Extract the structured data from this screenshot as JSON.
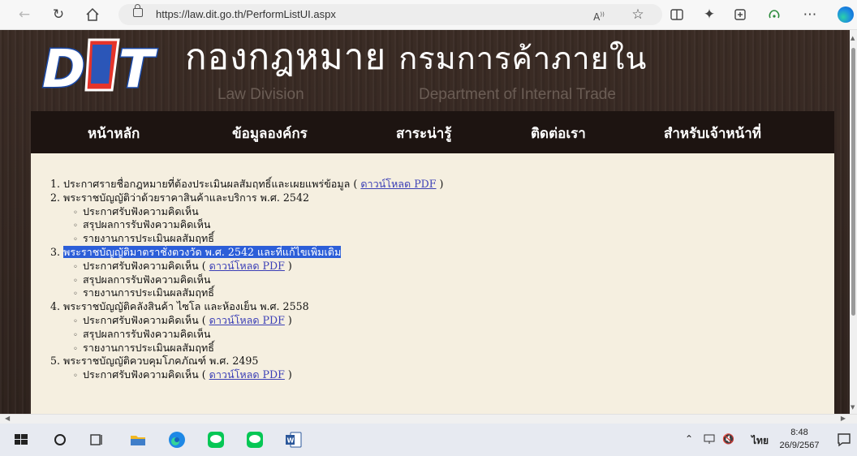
{
  "browser": {
    "url": "https://law.dit.go.th/PerformListUI.aspx",
    "icons": [
      "back-icon",
      "refresh-icon",
      "home-icon",
      "lock-icon",
      "read-aloud-icon",
      "favorite-star-icon",
      "split-screen-icon",
      "favorites-list-icon",
      "collections-icon",
      "performance-icon",
      "more-icon",
      "edge-copilot-icon"
    ]
  },
  "banner": {
    "title_th_part1": "กองกฎหมาย",
    "title_th_part2": "กรมการค้าภายใน",
    "title_en_division": "Law Division",
    "title_en_department": "Department of Internal Trade",
    "logo_text": "DIT"
  },
  "nav": {
    "items": [
      {
        "label": "หน้าหลัก"
      },
      {
        "label": "ข้อมูลองค์กร"
      },
      {
        "label": "สาระน่ารู้"
      },
      {
        "label": "ติดต่อเรา"
      },
      {
        "label": "สำหรับเจ้าหน้าที่"
      }
    ]
  },
  "content": {
    "download_label": "ดาวน์โหลด PDF",
    "items": [
      {
        "type": "main",
        "num": "1.",
        "text": "ประกาศรายชื่อกฎหมายที่ต้องประเมินผลสัมฤทธิ์และเผยแพร่ข้อมูล",
        "link": true
      },
      {
        "type": "main",
        "num": "2.",
        "text": "พระราชบัญญัติว่าด้วยราคาสินค้าและบริการ พ.ศ. 2542"
      },
      {
        "type": "sub",
        "text": "ประกาศรับฟังความคิดเห็น"
      },
      {
        "type": "sub",
        "text": "สรุปผลการรับฟังความคิดเห็น"
      },
      {
        "type": "sub",
        "text": "รายงานการประเมินผลสัมฤทธิ์"
      },
      {
        "type": "main",
        "num": "3.",
        "text": "พระราชบัญญัติมาตราชั่งตวงวัด พ.ศ. 2542 และที่แก้ไขเพิ่มเติม",
        "highlight": true
      },
      {
        "type": "sub",
        "text": "ประกาศรับฟังความคิดเห็น",
        "link": true
      },
      {
        "type": "sub",
        "text": "สรุปผลการรับฟังความคิดเห็น"
      },
      {
        "type": "sub",
        "text": "รายงานการประเมินผลสัมฤทธิ์"
      },
      {
        "type": "main",
        "num": "4.",
        "text": "พระราชบัญญัติคลังสินค้า ไซโล และห้องเย็น พ.ศ. 2558"
      },
      {
        "type": "sub",
        "text": "ประกาศรับฟังความคิดเห็น",
        "link": true
      },
      {
        "type": "sub",
        "text": "สรุปผลการรับฟังความคิดเห็น"
      },
      {
        "type": "sub",
        "text": "รายงานการประเมินผลสัมฤทธิ์"
      },
      {
        "type": "main",
        "num": "5.",
        "text": "พระราชบัญญัติควบคุมโภคภัณฑ์ พ.ศ. 2495"
      },
      {
        "type": "sub",
        "text": "ประกาศรับฟังความคิดเห็น",
        "link": true
      }
    ]
  },
  "taskbar": {
    "language": "ไทย",
    "time": "8:48",
    "date": "26/9/2567",
    "tray_icons": [
      "chevron-up-icon",
      "network-icon",
      "volume-muted-icon"
    ]
  },
  "colors": {
    "nav_bg": "#1d1411",
    "content_bg": "#f5efe0",
    "highlight": "#2c5ed8",
    "link": "#3b3fb6"
  }
}
